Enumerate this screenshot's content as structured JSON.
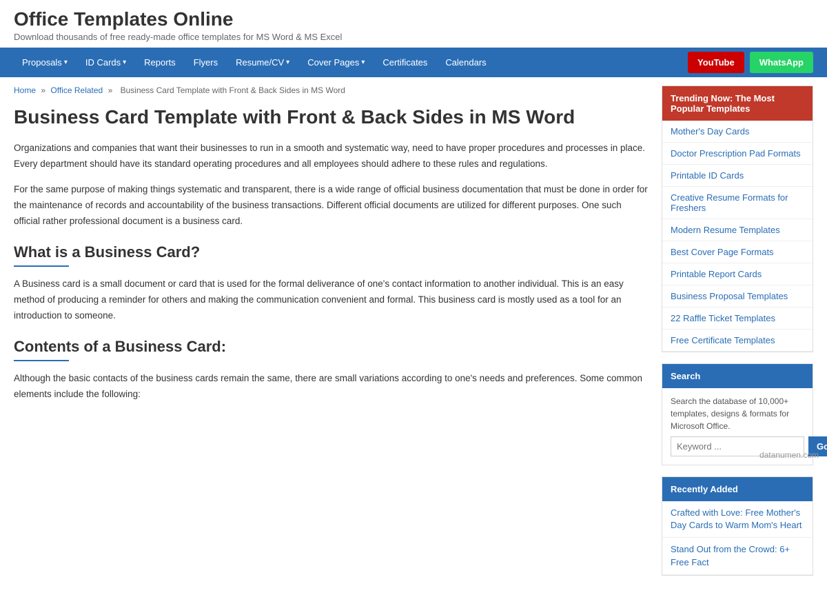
{
  "site": {
    "title": "Office Templates Online",
    "subtitle": "Download thousands of free ready-made office templates for MS Word & MS Excel"
  },
  "nav": {
    "items": [
      {
        "label": "Proposals",
        "dropdown": true
      },
      {
        "label": "ID Cards",
        "dropdown": true
      },
      {
        "label": "Reports",
        "dropdown": false
      },
      {
        "label": "Flyers",
        "dropdown": false
      },
      {
        "label": "Resume/CV",
        "dropdown": true
      },
      {
        "label": "Cover Pages",
        "dropdown": true
      },
      {
        "label": "Certificates",
        "dropdown": false
      },
      {
        "label": "Calendars",
        "dropdown": false
      }
    ],
    "youtube_label": "YouTube",
    "whatsapp_label": "WhatsApp"
  },
  "breadcrumb": {
    "home": "Home",
    "parent": "Office Related",
    "current": "Business Card Template with Front & Back Sides in MS Word"
  },
  "article": {
    "heading": "Business Card Template with Front & Back Sides in MS Word",
    "para1": "Organizations and companies that want their businesses to run in a smooth and systematic way, need to have proper procedures and processes in place. Every department should have its standard operating procedures and all employees should adhere to these rules and regulations.",
    "para2": "For the same purpose of making things systematic and transparent, there is a wide range of official business documentation that must be done in order for the maintenance of records and accountability of the business transactions. Different official documents are utilized for different purposes. One such official rather professional document is a business card.",
    "section1_heading": "What is a Business Card?",
    "section1_para": "A Business card is a small document or card that is used for the formal deliverance of one's contact information to another individual. This is an easy method of producing a reminder for others and making the communication convenient and formal.  This business card is mostly used as a tool for an introduction to someone.",
    "section2_heading": "Contents of a Business Card:",
    "section2_para": "Although the basic contacts of the business cards remain the same, there are small variations according to one's needs and preferences.  Some common elements include the following:"
  },
  "sidebar": {
    "trending_header": "Trending Now: The Most Popular Templates",
    "trending_items": [
      "Mother's Day Cards",
      "Doctor Prescription Pad Formats",
      "Printable ID Cards",
      "Creative Resume Formats for Freshers",
      "Modern Resume Templates",
      "Best Cover Page Formats",
      "Printable Report Cards",
      "Business Proposal Templates",
      "22 Raffle Ticket Templates",
      "Free Certificate Templates"
    ],
    "search_header": "Search",
    "search_desc": "Search the database of 10,000+ templates, designs & formats for Microsoft Office.",
    "search_placeholder": "Keyword ...",
    "search_go": "Go",
    "recently_added_header": "Recently Added",
    "recently_added_items": [
      "Crafted with Love: Free Mother's Day Cards to Warm Mom's Heart",
      "Stand Out from the Crowd: 6+ Free Fact"
    ]
  },
  "footer": {
    "watermark": "datanumen.com"
  }
}
